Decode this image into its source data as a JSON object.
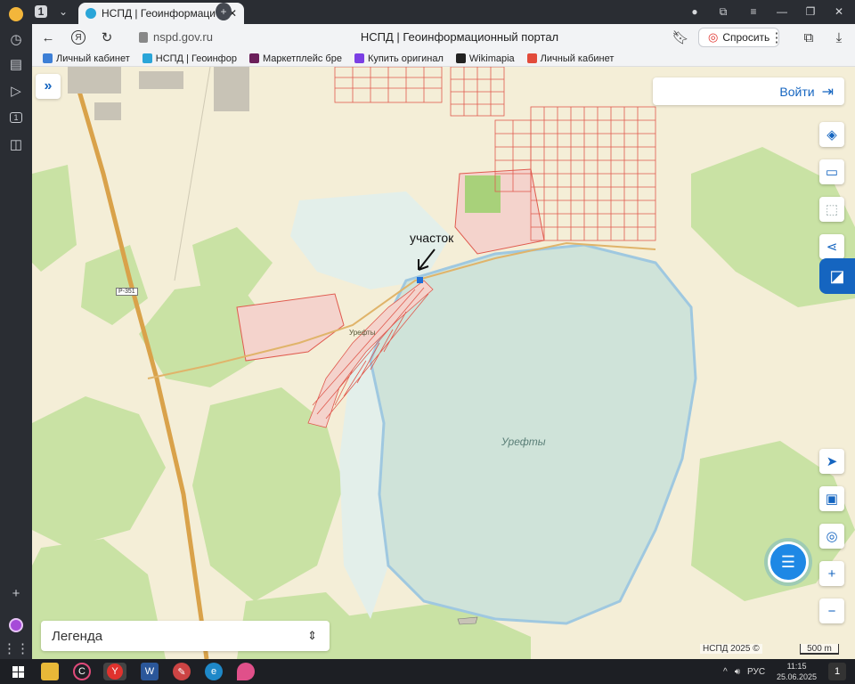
{
  "browser": {
    "tab_count": "1",
    "active_tab_title": "НСПД | Геоинформаци",
    "url": "nspd.gov.ru",
    "page_title": "НСПД | Геоинформационный портал",
    "ask_label": "Спросить",
    "bookmarks": [
      {
        "label": "Личный кабинет",
        "color": "#3d7fd6"
      },
      {
        "label": "НСПД | Геоинфор",
        "color": "#2aa5d8"
      },
      {
        "label": "Маркетплейс бре",
        "color": "#6b1f5a"
      },
      {
        "label": "Купить оригинал",
        "color": "#7b3fe4"
      },
      {
        "label": "Wikimapia",
        "color": "#222222"
      },
      {
        "label": "Личный кабинет",
        "color": "#e24b3b"
      }
    ]
  },
  "map": {
    "login_label": "Войти",
    "legend_label": "Легенда",
    "lake_name": "Урефты",
    "village_name": "Урефты",
    "annotation": "участок",
    "road_shield": "Р-351",
    "attribution": "НСПД 2025 ©",
    "scale_label": "500 m",
    "colors": {
      "land": "#f4eed7",
      "forest": "#c9e2a4",
      "lake": "#cfe3d9",
      "wetland": "#e3efea",
      "parcel": "#e05a4e",
      "road": "#d9a24a",
      "accent": "#1565c0"
    }
  },
  "taskbar": {
    "language": "РУС",
    "time": "11:15",
    "date": "25.06.2025",
    "notifications": "1"
  }
}
